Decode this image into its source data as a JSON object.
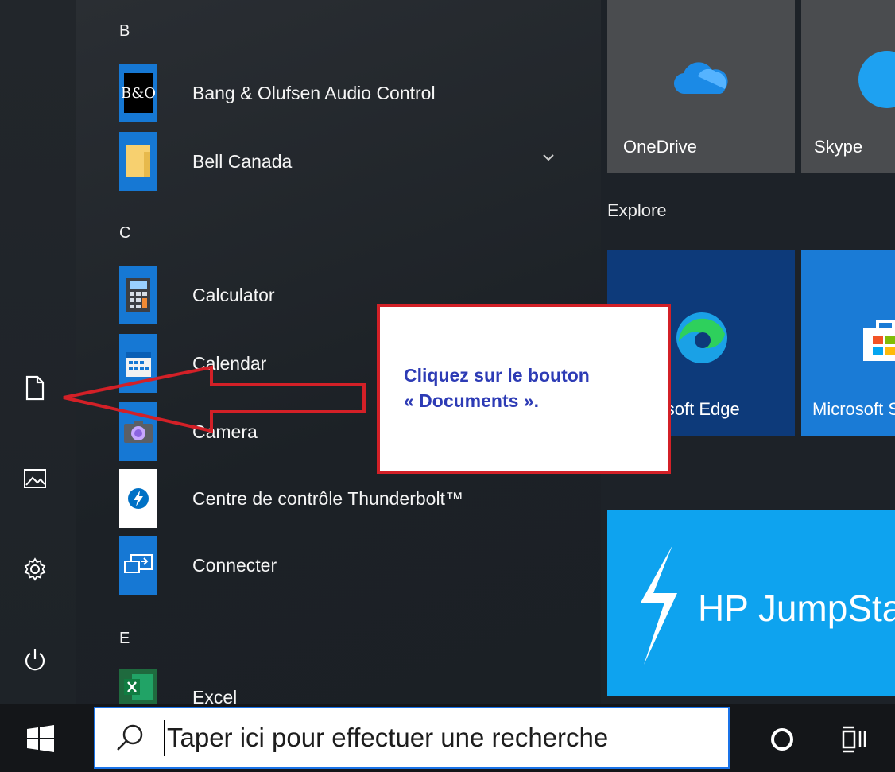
{
  "start_menu": {
    "sections": [
      {
        "letter": "B",
        "apps": [
          "Bang & Olufsen Audio Control",
          "Bell Canada"
        ]
      },
      {
        "letter": "C",
        "apps": [
          "Calculator",
          "Calendar",
          "Camera",
          "Centre de contrôle Thunderbolt™",
          "Connecter"
        ]
      },
      {
        "letter": "E",
        "apps": [
          "Excel"
        ]
      }
    ],
    "bo_logo_text": "B&O"
  },
  "tiles": {
    "onedrive": "OneDrive",
    "skype": "Skype",
    "explore_title": "Explore",
    "edge": "Microsoft Edge",
    "store": "Microsoft Store",
    "jumpstart": "HP JumpStart"
  },
  "callout": {
    "text": "Cliquez sur le bouton\n« Documents ».",
    "border_color": "#d32027",
    "text_color": "#2d3bb5"
  },
  "taskbar": {
    "search_placeholder": "Taper ici pour effectuer une recherche"
  },
  "icons": {
    "rail": [
      "documents-icon",
      "pictures-icon",
      "settings-icon",
      "power-icon"
    ],
    "taskbar": [
      "windows-start-icon",
      "search-icon",
      "cortana-icon",
      "task-view-icon"
    ]
  }
}
